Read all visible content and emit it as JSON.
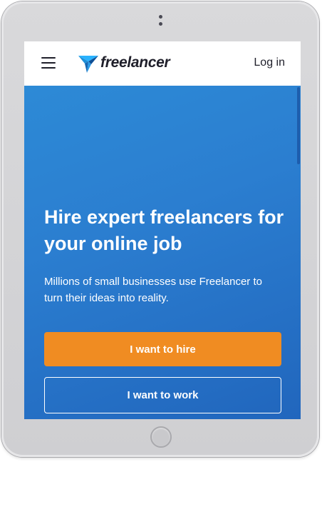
{
  "device": {
    "frame_color": "#d4d4d6",
    "home_button_icon": "home-button"
  },
  "navbar": {
    "menu_icon": "hamburger-menu-icon",
    "logo_text": "freelancer",
    "logo_icon": "freelancer-bird-icon",
    "login_label": "Log in"
  },
  "hero": {
    "headline": "Hire expert freelancers for your online job",
    "subtext": "Millions of small businesses use Freelancer to turn their ideas into reality.",
    "hire_button_label": "I want to hire",
    "work_button_label": "I want to work",
    "background_color": "#2b7ed0"
  },
  "colors": {
    "accent": "#f08c22",
    "brand_blue": "#29b2fe",
    "text_dark": "#1f1f2a"
  }
}
